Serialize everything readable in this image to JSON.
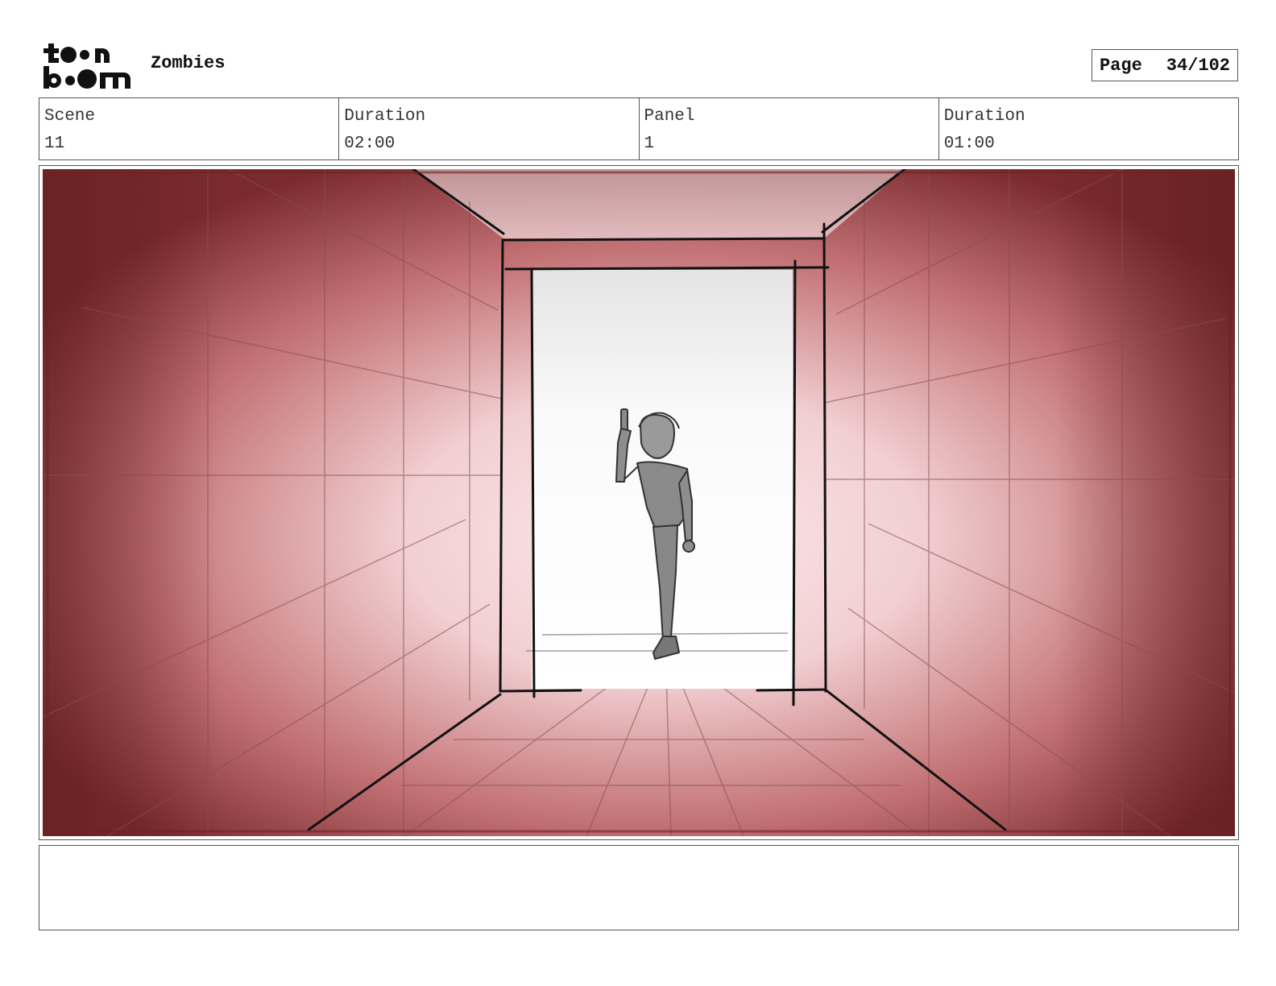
{
  "header": {
    "logo_text": "toon boom",
    "project_title": "Zombies",
    "page_label": "Page",
    "page_number": "34/102"
  },
  "info": {
    "scene_label": "Scene",
    "scene_value": "11",
    "scene_duration_label": "Duration",
    "scene_duration_value": "02:00",
    "panel_label": "Panel",
    "panel_value": "1",
    "panel_duration_label": "Duration",
    "panel_duration_value": "01:00"
  },
  "panel": {
    "image_subject": "sketch of a figure holding a pistol walking out of a bright doorway down a red-lit corridor"
  },
  "notes": {
    "text": ""
  },
  "colors": {
    "corridor_dark": "#7a2a2c",
    "corridor_light": "#f5d6d8",
    "line": "#111111",
    "frame": "#555555"
  }
}
